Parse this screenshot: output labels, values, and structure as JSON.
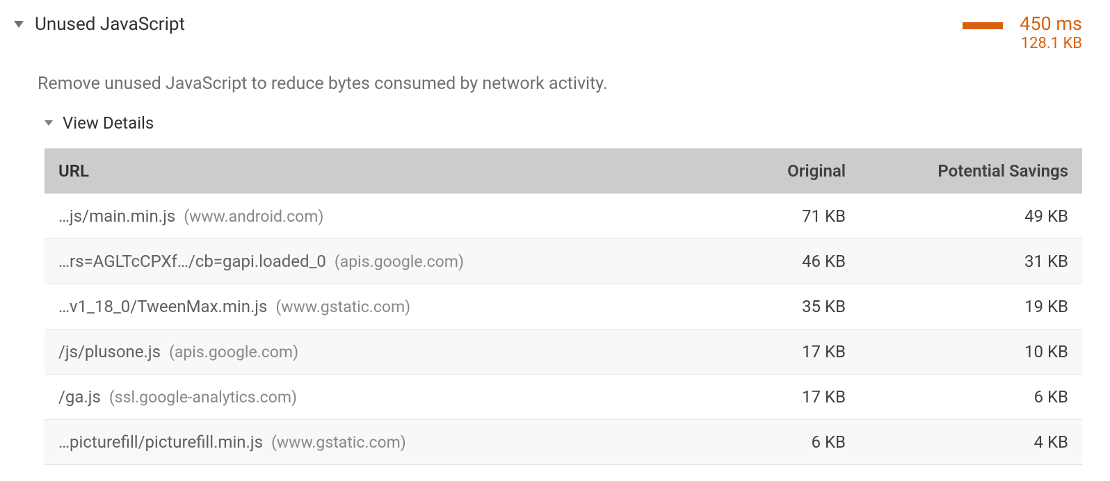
{
  "audit": {
    "title": "Unused JavaScript",
    "description": "Remove unused JavaScript to reduce bytes consumed by network activity.",
    "stats": {
      "time": "450 ms",
      "size": "128.1 KB"
    }
  },
  "details": {
    "toggle_label": "View Details",
    "headers": {
      "url": "URL",
      "original": "Original",
      "savings": "Potential Savings"
    },
    "rows": [
      {
        "path": "…js/main.min.js",
        "domain": "(www.android.com)",
        "original": "71 KB",
        "savings": "49 KB"
      },
      {
        "path": "…rs=AGLTcCPXf…/cb=gapi.loaded_0",
        "domain": "(apis.google.com)",
        "original": "46 KB",
        "savings": "31 KB"
      },
      {
        "path": "…v1_18_0/TweenMax.min.js",
        "domain": "(www.gstatic.com)",
        "original": "35 KB",
        "savings": "19 KB"
      },
      {
        "path": "/js/plusone.js",
        "domain": "(apis.google.com)",
        "original": "17 KB",
        "savings": "10 KB"
      },
      {
        "path": "/ga.js",
        "domain": "(ssl.google-analytics.com)",
        "original": "17 KB",
        "savings": "6 KB"
      },
      {
        "path": "…picturefill/picturefill.min.js",
        "domain": "(www.gstatic.com)",
        "original": "6 KB",
        "savings": "4 KB"
      }
    ]
  }
}
